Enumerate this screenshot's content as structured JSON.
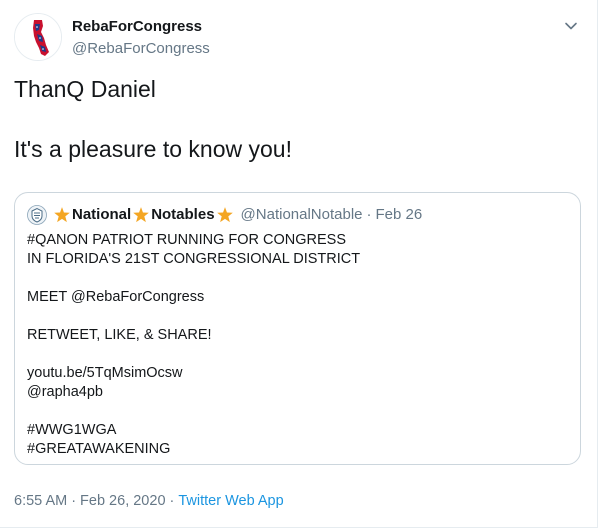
{
  "author": {
    "display_name": "RebaForCongress",
    "handle": "@RebaForCongress",
    "avatar_icon": "florida-flag-avatar-icon"
  },
  "menu_icon": "chevron-down-icon",
  "tweet": {
    "lines": [
      "ThanQ Daniel",
      "",
      "It's a pleasure to know you!"
    ]
  },
  "quoted": {
    "name_part1": "National",
    "name_part2": "Notables",
    "handle": "@NationalNotable",
    "separator": "·",
    "date": "Feb 26",
    "star_icon": "orange-star-icon",
    "avatar_icon": "qanon-crest-icon",
    "body": {
      "l1": "#QANON PATRIOT RUNNING FOR CONGRESS",
      "l2": "IN FLORIDA'S 21ST CONGRESSIONAL DISTRICT",
      "l3": "MEET @RebaForCongress",
      "l4": "RETWEET, LIKE, & SHARE!",
      "l5": "youtu.be/5TqMsimOcsw",
      "l6": "@rapha4pb",
      "l7": "#WWG1WGA",
      "l8": "#GREATAWAKENING"
    }
  },
  "meta": {
    "time": "6:55 AM",
    "separator1": "·",
    "date": "Feb 26, 2020",
    "separator2": "·",
    "app": "Twitter Web App"
  },
  "colors": {
    "text": "#14171a",
    "secondary": "#657786",
    "link": "#1b95e0",
    "border": "#ccd6dd",
    "star": "#f4a623"
  }
}
